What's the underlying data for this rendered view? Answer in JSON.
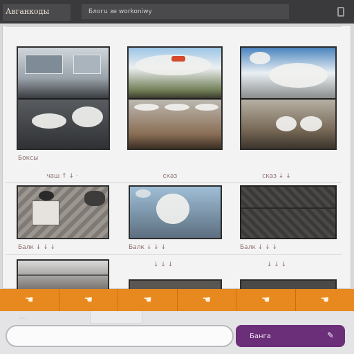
{
  "header": {
    "app_title": "Авганкоды",
    "search_text": "Блогu зе workoniwy"
  },
  "grid": {
    "row1": {
      "label_left": "Боксы"
    },
    "row2": {
      "caption_1": "чаш ↑ ↓ ·",
      "caption_2": "сказ",
      "caption_3": "сказ ↓ ↓"
    },
    "row3": {
      "caption_1": "Балк ↓ ↓ ↓",
      "caption_2": "Балк ↓ ↓ ↓",
      "caption_3": "Балк ↓ ↓ ↓"
    },
    "row4": {
      "caption_1": "↓ ↓ ↓",
      "caption_2": "↓ ↓ ↓",
      "caption_3": "↓ ↓ ↓"
    }
  },
  "action_bar": {
    "icons": [
      "hand-icon",
      "hand-icon",
      "hand-icon",
      "hand-icon",
      "hand-icon",
      "hand-icon"
    ]
  },
  "footer": {
    "mini_label": "····",
    "input_placeholder": "",
    "submit_label": "Банга",
    "colors": {
      "accent_orange": "#e8891f",
      "button_purple": "#6a2f78"
    }
  }
}
